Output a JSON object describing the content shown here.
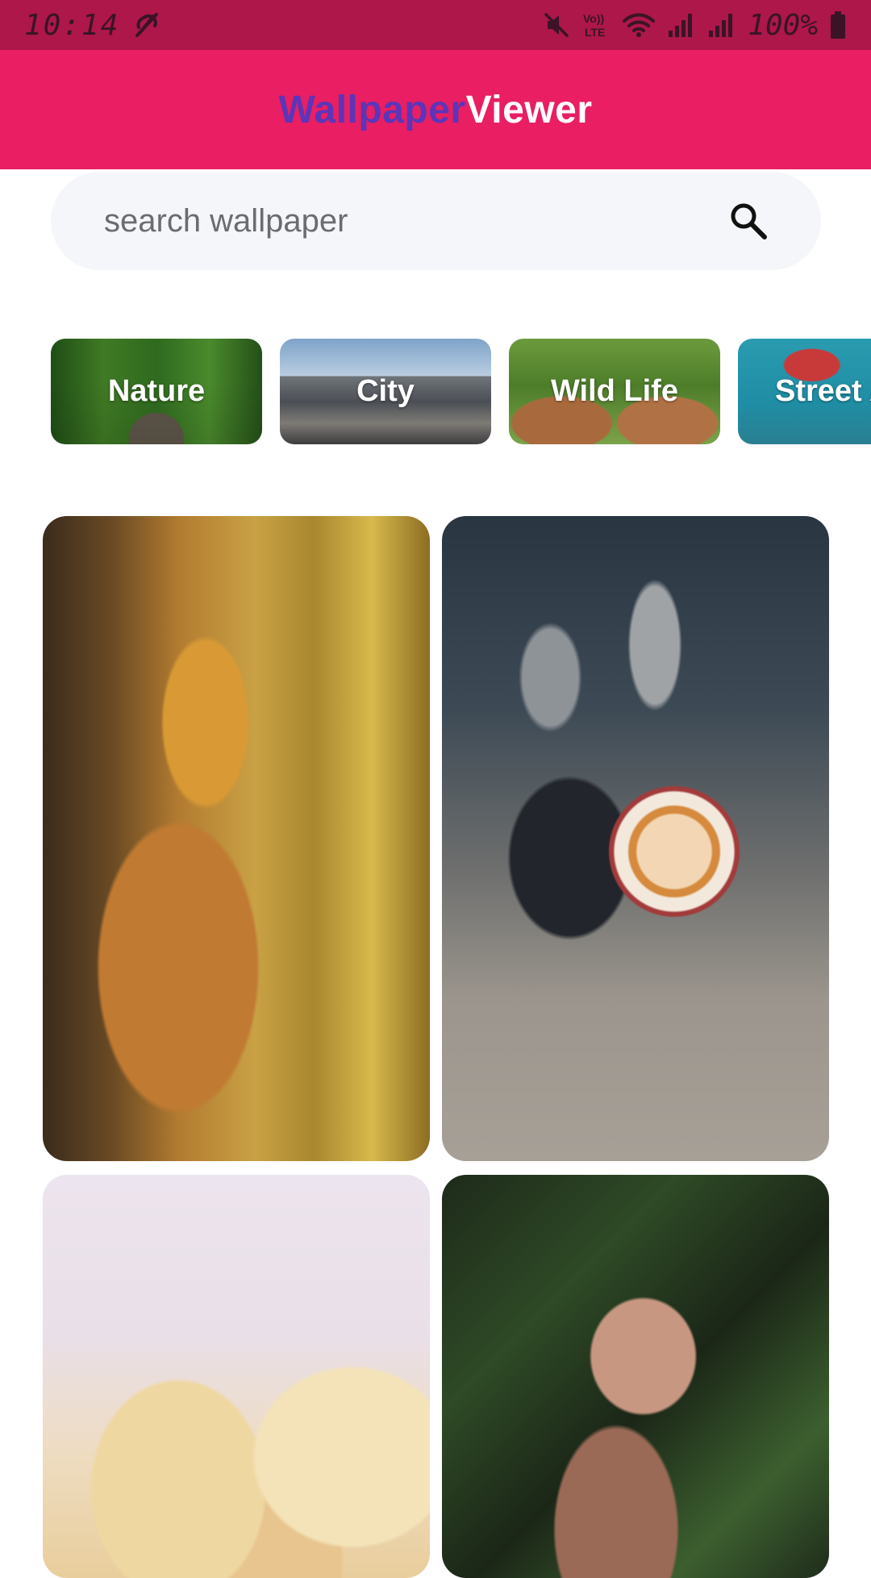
{
  "status_bar": {
    "time": "10:14",
    "battery": "100%",
    "network_label": "Vo)) LTE"
  },
  "app_bar": {
    "title_part1": "Wallpaper",
    "title_part2": "Viewer",
    "colors": {
      "bar": "#e91e63",
      "title_accent": "#5c35b8",
      "title_main": "#ffffff"
    }
  },
  "search": {
    "placeholder": "search wallpaper",
    "value": "",
    "icon": "search-icon"
  },
  "categories": [
    {
      "label": "Nature"
    },
    {
      "label": "City"
    },
    {
      "label": "Wild Life"
    },
    {
      "label": "Street Art"
    }
  ],
  "wallpapers": [
    {
      "subject": "portrait-woman-yellow-lights"
    },
    {
      "subject": "coffee-cup-on-concrete"
    },
    {
      "subject": "cream-roses"
    },
    {
      "subject": "portrait-woman-plants"
    }
  ]
}
